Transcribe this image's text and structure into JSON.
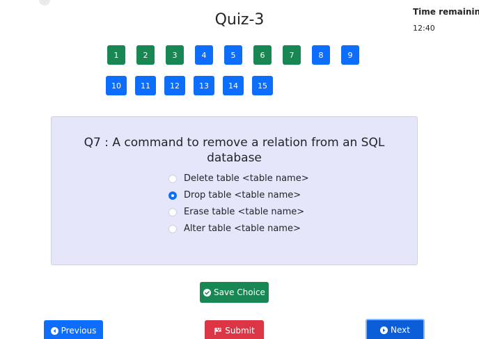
{
  "quiz": {
    "title": "Quiz-3",
    "timer_label": "Time remaining",
    "timer_value": "12:40"
  },
  "question_nav": [
    {
      "label": "1",
      "status": "answered"
    },
    {
      "label": "2",
      "status": "answered"
    },
    {
      "label": "3",
      "status": "answered"
    },
    {
      "label": "4",
      "status": "unanswered"
    },
    {
      "label": "5",
      "status": "unanswered"
    },
    {
      "label": "6",
      "status": "answered"
    },
    {
      "label": "7",
      "status": "answered"
    },
    {
      "label": "8",
      "status": "unanswered"
    },
    {
      "label": "9",
      "status": "unanswered"
    },
    {
      "label": "10",
      "status": "unanswered"
    },
    {
      "label": "11",
      "status": "unanswered"
    },
    {
      "label": "12",
      "status": "unanswered"
    },
    {
      "label": "13",
      "status": "unanswered"
    },
    {
      "label": "14",
      "status": "unanswered"
    },
    {
      "label": "15",
      "status": "unanswered"
    }
  ],
  "question": {
    "text": "Q7 : A command to remove a relation from an SQL database",
    "options": [
      {
        "label": "Delete table <table name>",
        "selected": false
      },
      {
        "label": "Drop table <table name>",
        "selected": true
      },
      {
        "label": "Erase table <table name>",
        "selected": false
      },
      {
        "label": "Alter table <table name>",
        "selected": false
      }
    ]
  },
  "buttons": {
    "save": "Save Choice",
    "previous": "Previous",
    "submit": "Submit",
    "next": "Next"
  },
  "icons": {
    "save": "check-circle-icon",
    "previous": "arrow-left-circle-icon",
    "submit": "flag-icon",
    "next": "arrow-right-circle-icon"
  },
  "colors": {
    "answered": "#198754",
    "unanswered": "#0d6efd",
    "card_background": "#e6e6fa",
    "submit": "#dc3545"
  }
}
